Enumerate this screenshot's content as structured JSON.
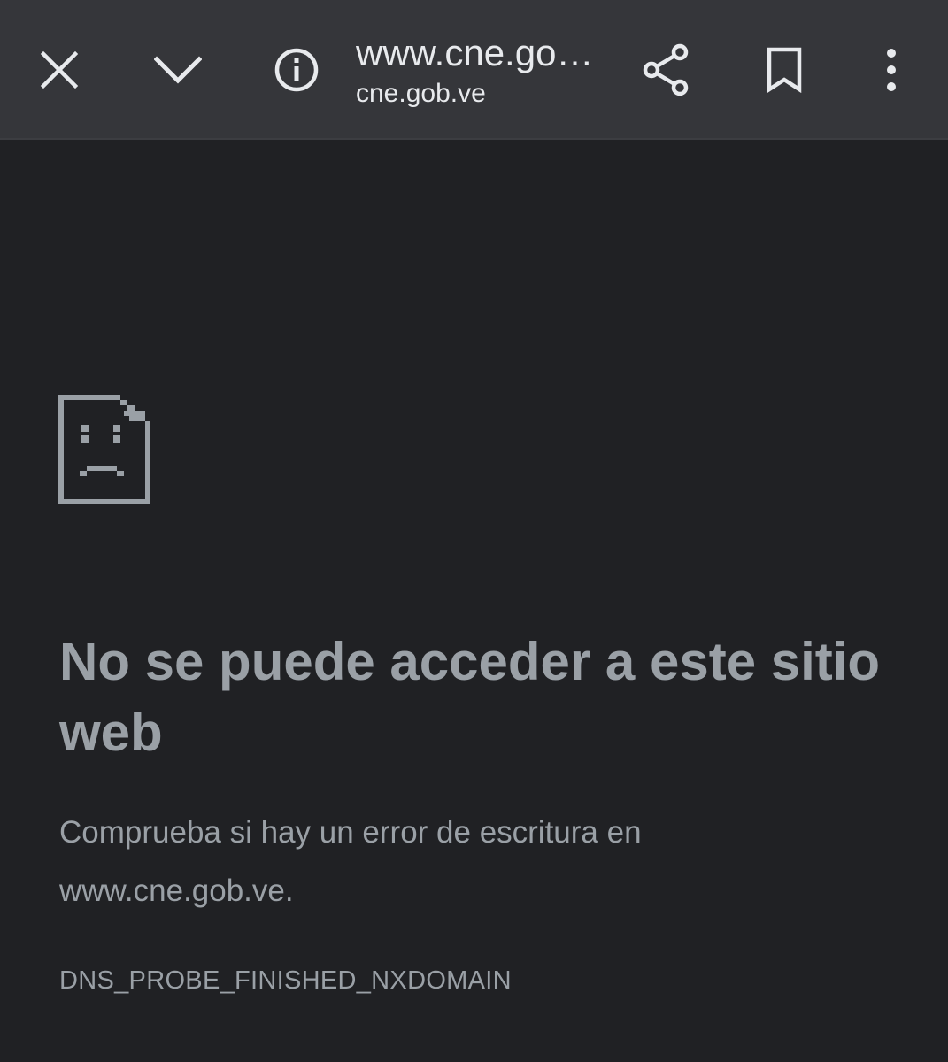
{
  "toolbar": {
    "close_icon": "close-icon",
    "minimize_icon": "chevron-down-icon",
    "info_icon": "info-icon",
    "url_title": "www.cne.go…",
    "url_domain": "cne.gob.ve",
    "share_icon": "share-icon",
    "bookmark_icon": "bookmark-icon",
    "menu_icon": "more-vert-icon"
  },
  "error": {
    "icon": "sad-page-icon",
    "heading": "No se puede acceder a este sitio web",
    "body_line1": "Comprueba si hay un error de escritura en",
    "body_line2": "www.cne.gob.ve.",
    "code": "DNS_PROBE_FINISHED_NXDOMAIN"
  },
  "colors": {
    "toolbar_bg": "#35363a",
    "page_bg": "#202124",
    "toolbar_text": "#e8eaed",
    "error_text": "#9aa0a6"
  }
}
